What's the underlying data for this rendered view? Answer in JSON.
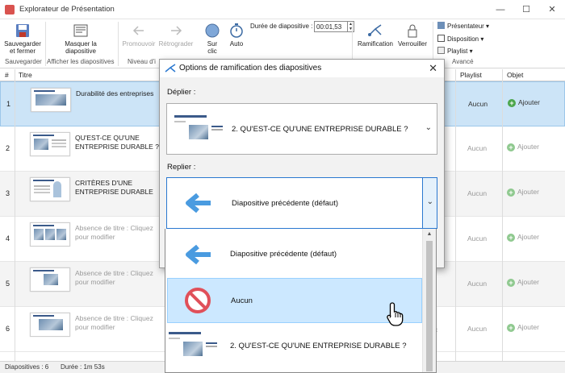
{
  "window": {
    "title": "Explorateur de Présentation",
    "minimize": "—",
    "maximize": "☐",
    "close": "✕"
  },
  "ribbon": {
    "save_close": "Sauvegarder et fermer",
    "hide_slide": "Masquer la diapositive",
    "promote": "Promouvoir",
    "demote": "Rétrograder",
    "on_click": "Sur clic",
    "auto": "Auto",
    "duration_label": "Durée de diapositive :",
    "duration_value": "00:01,53",
    "branching": "Ramification",
    "lock": "Verrouiller",
    "presenter": "Présentateur",
    "layout": "Disposition",
    "playlist": "Playlist",
    "groups": {
      "save": "Sauvegarder",
      "show_slides": "Afficher les diapositives",
      "level": "Niveau d'i",
      "advanced": "Avancé"
    }
  },
  "columns": {
    "num": "#",
    "title": "Titre",
    "playlist": "Playlist",
    "object": "Objet"
  },
  "rows": [
    {
      "num": "1",
      "title": "Durabilité des entreprises",
      "playlist": "Aucun",
      "object": "Ajouter"
    },
    {
      "num": "2",
      "title": "QU'EST-CE QU'UNE ENTREPRISE DURABLE ?",
      "playlist": "Aucun",
      "object": "Ajouter"
    },
    {
      "num": "3",
      "title": "CRITÈRES D'UNE ENTREPRISE DURABLE",
      "playlist": "Aucun",
      "object": "Ajouter"
    },
    {
      "num": "4",
      "title": "Absence de titre : Cliquez pour modifier",
      "playlist": "Aucun",
      "object": "Ajouter"
    },
    {
      "num": "5",
      "title": "Absence de titre : Cliquez pour modifier",
      "playlist": "Aucun",
      "object": "Ajouter"
    },
    {
      "num": "6",
      "title": "Absence de titre : Cliquez pour modifier",
      "playlist": "Aucun",
      "object": "Ajouter"
    }
  ],
  "status": {
    "slides": "Diapositives : 6",
    "duration": "Durée : 1m 53s"
  },
  "dialog": {
    "title": "Options de ramification des diapositives",
    "close": "✕",
    "expand_label": "Déplier :",
    "expand_value": "2. QU'EST-CE QU'UNE ENTREPRISE DURABLE ?",
    "collapse_label": "Replier :",
    "collapse_value": "Diapositive précédente (défaut)",
    "options": [
      "Diapositive précédente (défaut)",
      "Aucun",
      "2. QU'EST-CE QU'UNE ENTREPRISE DURABLE ?"
    ]
  },
  "colors": {
    "selected_row": "#cce4f7",
    "accent_blue": "#2a78d0",
    "arrow_blue": "#4a9be0",
    "add_green": "#4ca64c",
    "no_red": "#e0505a"
  },
  "icons": {
    "edge_char": "c"
  }
}
